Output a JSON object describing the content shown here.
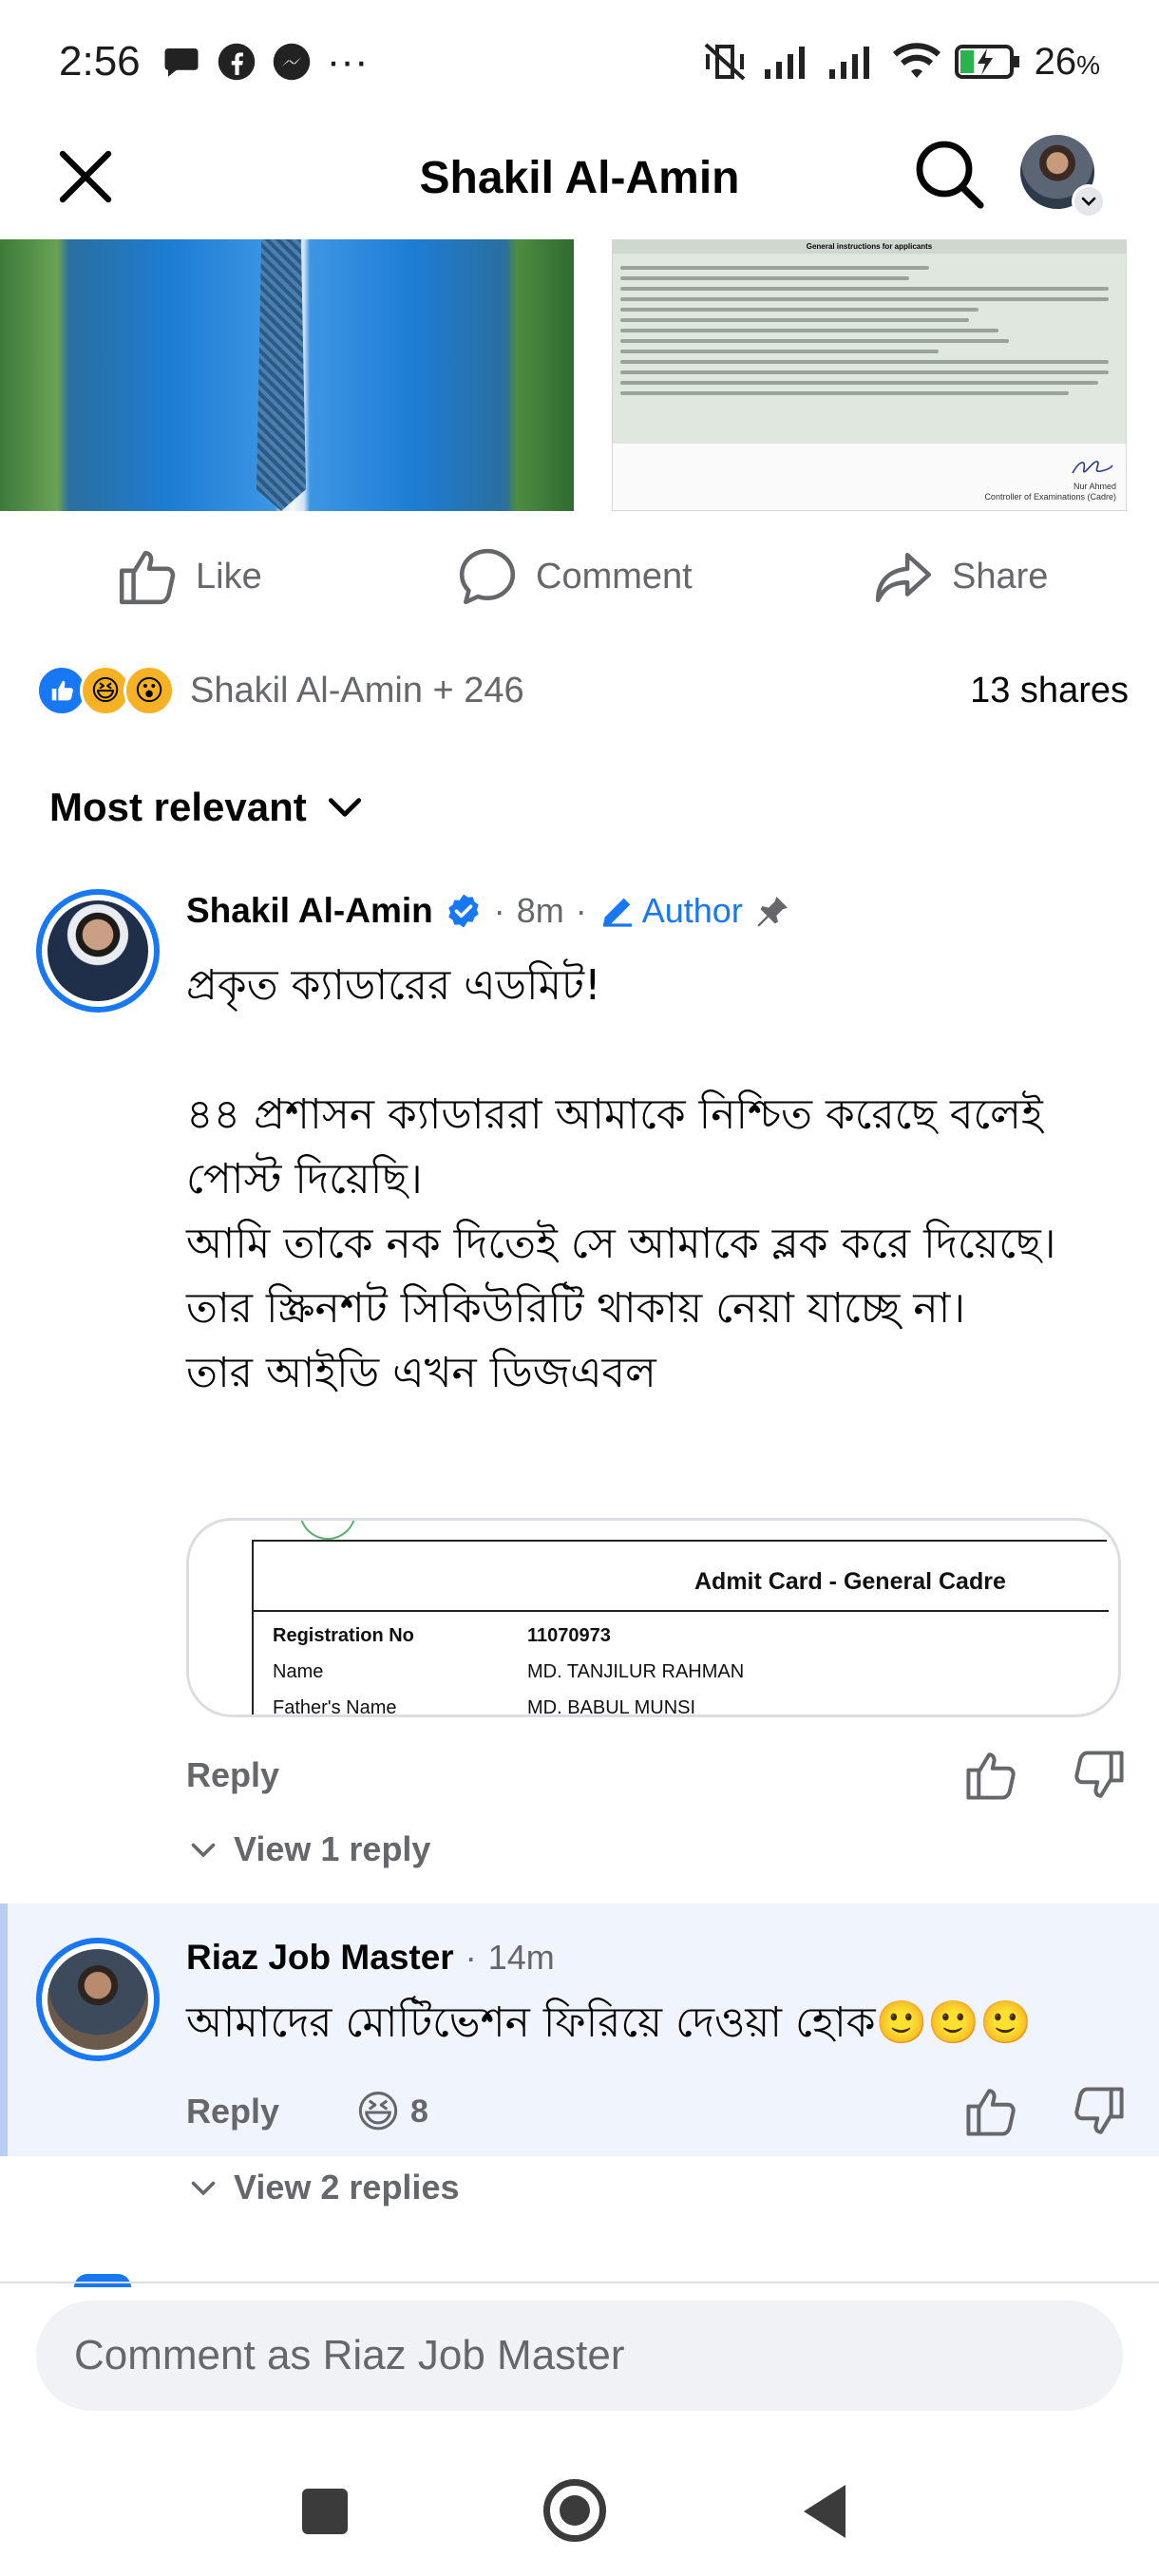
{
  "status_bar": {
    "time": "2:56",
    "battery": "26",
    "battery_unit": "%",
    "more": "···"
  },
  "header": {
    "title": "Shakil Al-Amin"
  },
  "post_image_doc": {
    "heading": "General instructions for applicants",
    "signature_name": "Nur Ahmed",
    "signature_title": "Controller of Examinations (Cadre)"
  },
  "actions": {
    "like": "Like",
    "comment": "Comment",
    "share": "Share"
  },
  "reactions": {
    "summary": "Shakil Al-Amin + 246",
    "shares": "13 shares"
  },
  "sort": {
    "label": "Most relevant"
  },
  "comments": [
    {
      "name": "Shakil Al-Amin",
      "time": "8m",
      "author_badge": "Author",
      "lines": [
        "প্রকৃত ক্যাডারের এডমিট!",
        "৪৪ প্রশাসন ক্যাডাররা আমাকে নিশ্চিত করেছে বলেই পোস্ট দিয়েছি।",
        "আমি তাকে নক দিতেই সে আমাকে ব্লক করে দিয়েছে। তার স্ক্রিনশট সিকিউরিটি থাকায় নেয়া যাচ্ছে না।",
        "তার আইডি এখন ডিজএবল"
      ],
      "admit_card": {
        "title": "Admit Card - General Cadre",
        "rows": [
          {
            "label": "Registration No",
            "value": "11070973"
          },
          {
            "label": "Name",
            "value": "MD. TANJILUR RAHMAN"
          },
          {
            "label": "Father's Name",
            "value": "MD. BABUL MUNSI"
          }
        ]
      },
      "reply": "Reply",
      "view_replies": "View 1 reply"
    },
    {
      "name": "Riaz Job Master",
      "time": "14m",
      "text": "আমাদের মোটিভেশন ফিরিয়ে দেওয়া হোক🙂🙂🙂",
      "reply": "Reply",
      "reaction_count": "8",
      "view_replies": "View 2 replies"
    }
  ],
  "composer": {
    "placeholder": "Comment as Riaz Job Master"
  }
}
